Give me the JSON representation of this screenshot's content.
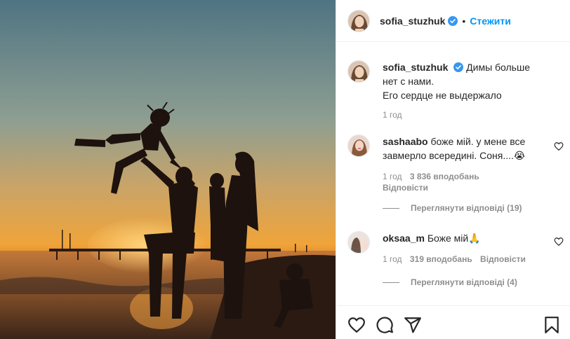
{
  "post": {
    "author": "sofia_stuzhuk",
    "follow_label": "Стежити",
    "separator": "•",
    "caption_line1": "Димы больше нет с нами.",
    "caption_line2": "Его сердце не выдержало",
    "caption_time": "1 год"
  },
  "comments": [
    {
      "username": "sashaabo",
      "text": "боже мій. у мене все завмерло всередині. Соня....😭",
      "time": "1 год",
      "likes": "3 836 вподобань",
      "reply_label": "Відповісти",
      "view_replies": "Переглянути відповіді (19)"
    },
    {
      "username": "oksaa_m",
      "text": "Боже мій🙏",
      "time": "1 год",
      "likes": "319 вподобань",
      "reply_label": "Відповісти",
      "view_replies": "Переглянути відповіді (4)"
    }
  ],
  "icons": {
    "verified": "verified-badge-icon",
    "like": "heart-icon",
    "comment": "comment-bubble-icon",
    "share": "paper-plane-icon",
    "save": "bookmark-icon"
  },
  "colors": {
    "link_blue": "#0095f6",
    "secondary_text": "#8e8e8e",
    "border": "#efefef",
    "sky_top": "#5b7e8c",
    "sunset": "#e8a13c"
  }
}
